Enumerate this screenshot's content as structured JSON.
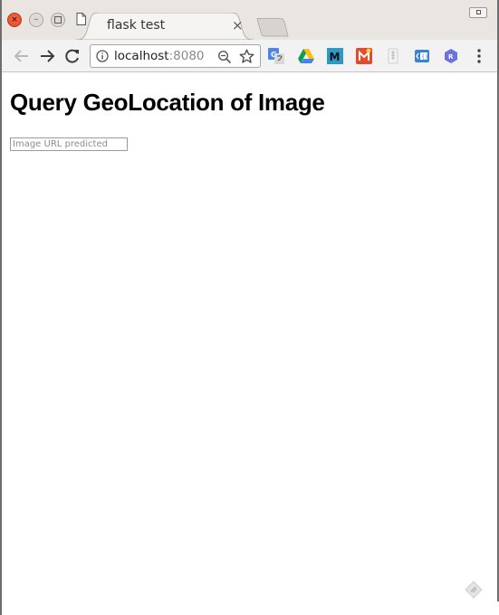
{
  "browser": {
    "tab": {
      "title": "flask test",
      "close_glyph": "×",
      "icon": "document-icon"
    },
    "window_controls": {
      "close_glyph": "×",
      "minimize_glyph": "–"
    },
    "address_bar": {
      "host": "localhost",
      "port": ":8080"
    },
    "extensions": [
      "google-translate-icon",
      "google-drive-icon",
      "m-extension-icon",
      "red-extension-icon",
      "zip-extension-icon",
      "blue-code-extension-icon",
      "r-hexagon-icon"
    ],
    "colors": {
      "close_button": "#df4a25",
      "tabstrip": "#e9e6e2",
      "toolbar": "#f2f2f2"
    }
  },
  "page": {
    "heading": "Query GeoLocation of Image",
    "input": {
      "placeholder": "Image URL predicted",
      "value": ""
    }
  }
}
